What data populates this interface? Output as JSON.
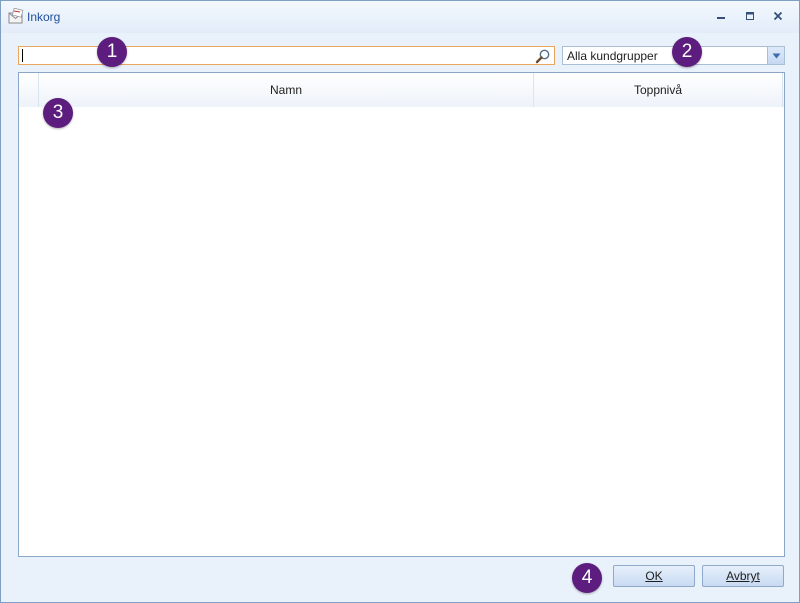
{
  "window": {
    "title": "Inkorg",
    "icon": "inbox-envelope-icon",
    "controls": {
      "minimize": "minimize-icon",
      "restore": "restore-icon",
      "close": "close-icon"
    }
  },
  "search": {
    "value": "",
    "placeholder": "",
    "icon": "search-icon"
  },
  "customer_group_filter": {
    "selected": "Alla kundgrupper"
  },
  "grid": {
    "columns": [
      "Namn",
      "Toppnivå"
    ],
    "rows": []
  },
  "callouts": [
    "1",
    "2",
    "3",
    "4"
  ],
  "footer": {
    "ok_label": "OK",
    "cancel_label": "Avbryt"
  },
  "colors": {
    "callout_badge": "#5d1d7e",
    "title_text": "#1f4e9a",
    "search_focus_border": "#e8a65e"
  }
}
